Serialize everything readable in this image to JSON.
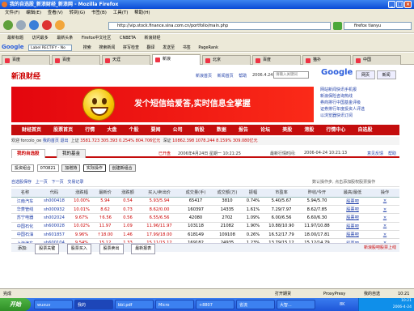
{
  "window": {
    "title": "我的自选股_新浪财经_新浪网 - Mozilla Firefox",
    "menus": [
      "文件(F)",
      "编辑(E)",
      "查看(V)",
      "转到(G)",
      "书签(B)",
      "工具(T)",
      "帮助(H)"
    ]
  },
  "navbar": {
    "url": "http://vip.stock.finance.sina.com.cn/portfolio/main.php",
    "search_value": "firefox tianyu"
  },
  "personal_toolbar": [
    "最新标题",
    "访问最多",
    "最新头条",
    "Firefox中文社区",
    "CNBETA",
    "新浪财经"
  ],
  "google_toolbar": {
    "logo": "Google",
    "input": "Label RECTIFY - No",
    "items": [
      "搜索",
      "搜索新闻",
      "拼写检查",
      "翻译",
      "发送至",
      "书签",
      "PageRank"
    ]
  },
  "tabs": [
    {
      "label": "百度",
      "active": false
    },
    {
      "label": "百度",
      "active": false
    },
    {
      "label": "天涯",
      "active": false
    },
    {
      "label": "新浪",
      "active": true
    },
    {
      "label": "北京",
      "active": false
    },
    {
      "label": "百度",
      "active": false
    },
    {
      "label": "猫扑",
      "active": false
    },
    {
      "label": "中国",
      "active": false
    }
  ],
  "page": {
    "logo_brand": "新浪财经",
    "logo_sub": "新浪财经",
    "top_links": [
      "新浪首页",
      "新闻首页",
      "帮助"
    ],
    "top_date": "2006.4.24",
    "top_search_placeholder": "请输入关键词",
    "google": {
      "logo": "Google",
      "tabs": [
        "网页",
        "新闻"
      ]
    },
    "banner_slogan": "发个短信给爱答,实时信息全掌握",
    "side_links": [
      "网站新闻快讯手机报",
      "新浪保险咨询热线",
      "券商排行中国基金评级",
      "证券排行年度投资人评选",
      "以浏览器快讯订阅"
    ],
    "main_nav": [
      "财经首页",
      "股票首页",
      "行情",
      "大盘",
      "个股",
      "要闻",
      "公司",
      "新股",
      "数据",
      "报告",
      "论坛",
      "美股",
      "港股",
      "行情中心",
      "自选股"
    ],
    "ticker": {
      "user": "欢迎 forcolo_oe",
      "links": [
        "我的首页",
        "退出"
      ],
      "sh_label": "上证",
      "sh_value": "3581.723 305.393 0.254% 804.706亿元",
      "sz_label": "深证",
      "sz_value": "10862.398 1078.244 8.159% 309.080亿元"
    },
    "subtabs": [
      {
        "label": "我的自选股",
        "active": true
      },
      {
        "label": "我的基金",
        "active": false
      }
    ],
    "subinfo_refresh": "已开盘",
    "subinfo_time": "2006年4月24日 星期一 10:21:25",
    "subinfo_latest_label": "最新行情时间:",
    "subinfo_latest": "2006-04-24 10:21:13",
    "subinfo_links": [
      "意见反馈",
      "帮助"
    ],
    "controls": {
      "portfolio_label": "投资组合",
      "portfolio_value": "070821",
      "add_button": "加增持",
      "actual_button": "实际操作",
      "create_button": "创建新组合"
    },
    "options": {
      "links": [
        "自选股保存",
        "上一页",
        "下一页",
        "交易记录"
      ],
      "hint": "数认操作步, 点击添加股权股票操作"
    },
    "table": {
      "headers": [
        "名称",
        "代码",
        "涨跌幅",
        "最新价",
        "涨跌额",
        "买入/卖出价",
        "成交量(手)",
        "成交额(万)",
        "振幅",
        "市盈率",
        "昨收/今开",
        "最高/最低",
        "操作"
      ],
      "rows": [
        [
          "江南汽车",
          "sh000418",
          "10.00%",
          "5.94",
          "0.54",
          "5.93/5.94",
          "65417",
          "3810",
          "0.74%",
          "5.40/5.67",
          "5.94/5.70",
          "股票吧"
        ],
        [
          "华菱管线",
          "sh000932",
          "10.01%",
          "8.62",
          "0.73",
          "8.62/0.00",
          "160397",
          "14335",
          "1.61%",
          "7.29/7.97",
          "8.62/7.85",
          "股票吧"
        ],
        [
          "苏宁电器",
          "sh002024",
          "9.67%",
          "↑6.56",
          "0.56",
          "6.55/6.56",
          "42080",
          "2702",
          "1.09%",
          "6.00/6.56",
          "6.60/6.30",
          "股票吧"
        ],
        [
          "中国石化",
          "sh600028",
          "10.02%",
          "11.97",
          "1.09",
          "11.96/11.97",
          "103118",
          "21082",
          "1.90%",
          "10.88/10.90",
          "11.97/10.88",
          "股票吧"
        ],
        [
          "中国石油",
          "sh601857",
          "9.96%",
          "↑18.00",
          "1.46",
          "17.99/18.00",
          "618149",
          "109108",
          "0.26%",
          "16.52/17.79",
          "18.00/17.81",
          "股票吧"
        ],
        [
          "上海汽车",
          "sh600104",
          "9.54%",
          "15.12",
          "1.33",
          "15.11/15.12",
          "169182",
          "24935",
          "1.23%",
          "13.79/15.12",
          "15.12/14.79",
          "股票吧"
        ]
      ]
    },
    "bottom_bar": {
      "label": "添加:",
      "buttons": [
        "股票关键",
        "股票买入",
        "股票卖出",
        "最新报表"
      ],
      "right_link": "新浪股吧股票上线"
    }
  },
  "statusbar": {
    "left": "完成",
    "items": [
      "打开期货",
      "ProxyPresy",
      "我的自选"
    ],
    "right": "10:21"
  },
  "taskbar": {
    "start": "开始",
    "tasks": [
      "wuxuv",
      "我的",
      "bbl.pdf",
      "Micro",
      "+8807",
      "省流",
      "大智..."
    ],
    "tray_time": "10:21",
    "tray_date": "2006-4-24",
    "tray_info": "8K"
  },
  "colors": {
    "sina_red": "#c40d0d",
    "link_blue": "#1f3ea8",
    "xp_blue": "#0a4bd6"
  }
}
